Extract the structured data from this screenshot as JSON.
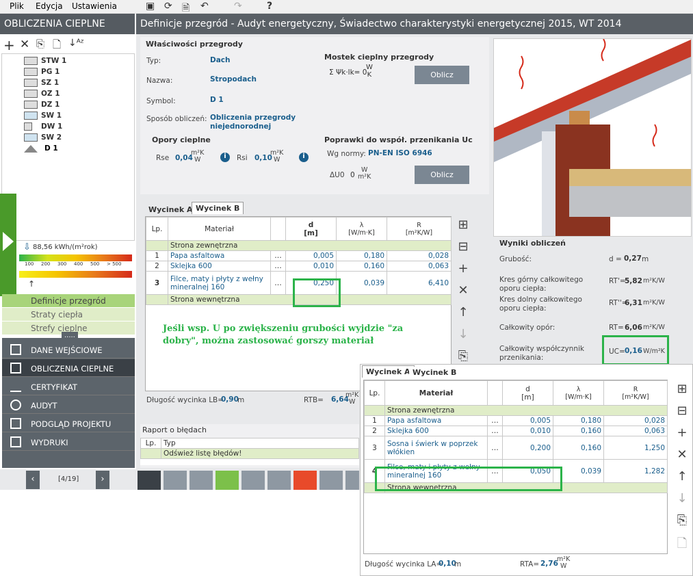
{
  "menu": {
    "items": [
      "Plik",
      "Edycja",
      "Ustawienia"
    ]
  },
  "left": {
    "title": "OBLICZENIA CIEPLNE",
    "tree": [
      {
        "label": "STW 1"
      },
      {
        "label": "PG 1"
      },
      {
        "label": "SZ 1"
      },
      {
        "label": "OZ 1"
      },
      {
        "label": "DZ 1"
      },
      {
        "label": "SW 1"
      },
      {
        "label": "DW 1"
      },
      {
        "label": "SW 2"
      },
      {
        "label": "D 1"
      }
    ],
    "energy": {
      "value": "88,56 kWh/(m²rok)",
      "ticks": [
        "100",
        "200",
        "300",
        "400",
        "500",
        "> 500"
      ]
    },
    "subnav": [
      "Definicje przegród",
      "Straty ciepła",
      "Strefy cieplne"
    ],
    "more": ".....",
    "nav": [
      "DANE WEJŚCIOWE",
      "OBLICZENIA CIEPLNE",
      "CERTYFIKAT",
      "AUDYT",
      "PODGLĄD PROJEKTU",
      "WYDRUKI"
    ],
    "pager": "[4/19]"
  },
  "header": {
    "title": "Definicje przegród - Audyt energetyczny, Świadectwo charakterystyki energetycznej 2015, WT 2014"
  },
  "props": {
    "section": "Właściwości przegrody",
    "fields": [
      {
        "label": "Typ:",
        "value": "Dach"
      },
      {
        "label": "Nazwa:",
        "value": "Stropodach"
      },
      {
        "label": "Symbol:",
        "value": "D 1"
      },
      {
        "label": "Sposób obliczeń:",
        "value": "Obliczenia przegrody niejednorodnej"
      }
    ]
  },
  "bridge": {
    "section": "Mostek cieplny przegrody",
    "formula": "Σ Ψk·lk= 0",
    "unit_num": "W",
    "unit_den": "K",
    "button": "Oblicz"
  },
  "resist": {
    "section": "Opory cieplne",
    "rse_label": "Rse",
    "rse": "0,04",
    "rsi_label": "Rsi",
    "rsi": "0,10",
    "unit_num": "m²K",
    "unit_den": "W"
  },
  "corrections": {
    "section": "Poprawki do współ. przenikania Uc",
    "norm_label": "Wg normy:",
    "norm": "PN-EN ISO 6946",
    "du_label": "ΔU0",
    "du": "0",
    "unit_num": "W",
    "unit_den": "m²K",
    "button": "Oblicz"
  },
  "tableB": {
    "tabs": [
      "Wycinek A",
      "Wycinek B"
    ],
    "headers": [
      "Lp.",
      "Materiał",
      "d\n[m]",
      "λ\n[W/m·K]",
      "R\n[m²K/W]"
    ],
    "outer": "Strona zewnętrzna",
    "inner": "Strona wewnętrzna",
    "rows": [
      {
        "lp": "1",
        "mat": "Papa asfaltowa",
        "d": "0,005",
        "l": "0,180",
        "r": "0,028"
      },
      {
        "lp": "2",
        "mat": "Sklejka 600",
        "d": "0,010",
        "l": "0,160",
        "r": "0,063"
      },
      {
        "lp": "3",
        "mat": "Filce, maty i płyty z wełny mineralnej 160",
        "d": "0,250",
        "l": "0,039",
        "r": "6,410"
      }
    ],
    "length_label": "Długość wycinka LB=",
    "length": "0,90",
    "length_unit": "m",
    "rt_label": "RTB=",
    "rt": "6,64",
    "rt_unit_num": "m²K",
    "rt_unit_den": "W"
  },
  "note": "Jeśli wsp. U po zwiększeniu grubości wyjdzie \"za dobry\", można zastosować gorszy materiał",
  "errors": {
    "section": "Raport o błędach",
    "headers": [
      "Lp.",
      "Typ"
    ],
    "row": "Odśwież listę błędów!"
  },
  "results": {
    "section": "Wyniki obliczeń",
    "items": [
      {
        "label": "Grubość:",
        "sym": "d =",
        "value": "0,27",
        "unit": "m"
      },
      {
        "label": "Kres górny całkowitego oporu ciepła:",
        "sym": "RT'=",
        "value": "5,82",
        "unit": "m²K/W"
      },
      {
        "label": "Kres dolny całkowitego oporu ciepła:",
        "sym": "RT''=",
        "value": "6,31",
        "unit": "m²K/W"
      },
      {
        "label": "Całkowity opór:",
        "sym": "RT=",
        "value": "6,06",
        "unit": "m²K/W"
      },
      {
        "label": "Całkowity współczynnik przenikania:",
        "sym": "UC=",
        "value": "0,16",
        "unit": "W/m²K"
      }
    ]
  },
  "tableA": {
    "tabs": [
      "Wycinek A",
      "Wycinek B"
    ],
    "headers": [
      "Lp.",
      "Materiał",
      "d\n[m]",
      "λ\n[W/m·K]",
      "R\n[m²K/W]"
    ],
    "outer": "Strona zewnętrzna",
    "inner": "Strona wewnętrzna",
    "rows": [
      {
        "lp": "1",
        "mat": "Papa asfaltowa",
        "d": "0,005",
        "l": "0,180",
        "r": "0,028"
      },
      {
        "lp": "2",
        "mat": "Sklejka 600",
        "d": "0,010",
        "l": "0,160",
        "r": "0,063"
      },
      {
        "lp": "3",
        "mat": "Sosna i świerk w poprzek włókien",
        "d": "0,200",
        "l": "0,160",
        "r": "1,250"
      },
      {
        "lp": "4",
        "mat": "Filce, maty i płyty z wełny mineralnej 160",
        "d": "0,050",
        "l": "0,039",
        "r": "1,282"
      }
    ],
    "length_label": "Długość wycinka LA=",
    "length": "0,10",
    "length_unit": "m",
    "rt_label": "RTA=",
    "rt": "2,76",
    "rt_unit_num": "m²K",
    "rt_unit_den": "W"
  },
  "colors": {
    "accent": "#2cb34a",
    "value": "#1a5e8c",
    "navbg": "#5c646b"
  }
}
